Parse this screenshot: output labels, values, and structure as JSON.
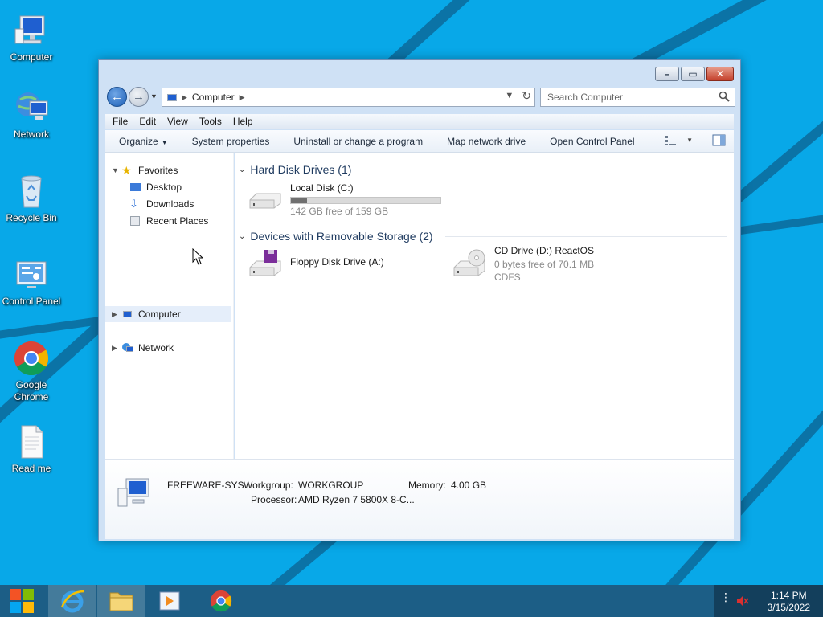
{
  "desktop": {
    "icons": [
      {
        "label": "Computer"
      },
      {
        "label": "Network"
      },
      {
        "label": "Recycle Bin"
      },
      {
        "label": "Control Panel"
      },
      {
        "label": "Google Chrome"
      },
      {
        "label": "Read me"
      }
    ]
  },
  "window": {
    "address": {
      "crumb": "Computer"
    },
    "search": {
      "placeholder": "Search Computer"
    },
    "menu": [
      "File",
      "Edit",
      "View",
      "Tools",
      "Help"
    ],
    "commands": [
      "Organize",
      "System properties",
      "Uninstall or change a program",
      "Map network drive",
      "Open Control Panel"
    ],
    "nav": {
      "favorites": "Favorites",
      "desktop": "Desktop",
      "downloads": "Downloads",
      "recent": "Recent Places",
      "computer": "Computer",
      "network": "Network"
    },
    "groups": {
      "hdd": "Hard Disk Drives (1)",
      "removable": "Devices with Removable Storage (2)"
    },
    "drives": {
      "c": {
        "name": "Local Disk (C:)",
        "info": "142 GB free of 159 GB",
        "used_fraction": 0.107
      },
      "a": {
        "name": "Floppy Disk Drive (A:)"
      },
      "d": {
        "name": "CD Drive (D:) ReactOS",
        "info": "0 bytes free of 70.1 MB",
        "fs": "CDFS"
      }
    },
    "details": {
      "name": "FREEWARE-SYS",
      "workgroup_label": "Workgroup:",
      "workgroup": "WORKGROUP",
      "memory_label": "Memory:",
      "memory": "4.00 GB",
      "processor_label": "Processor:",
      "processor": "AMD Ryzen 7 5800X 8-C..."
    }
  },
  "taskbar": {
    "time": "1:14 PM",
    "date": "3/15/2022"
  },
  "colors": {
    "desktop": "#08a8e8",
    "taskbar": "#1c5e86",
    "accent": "#1d5fb5"
  }
}
